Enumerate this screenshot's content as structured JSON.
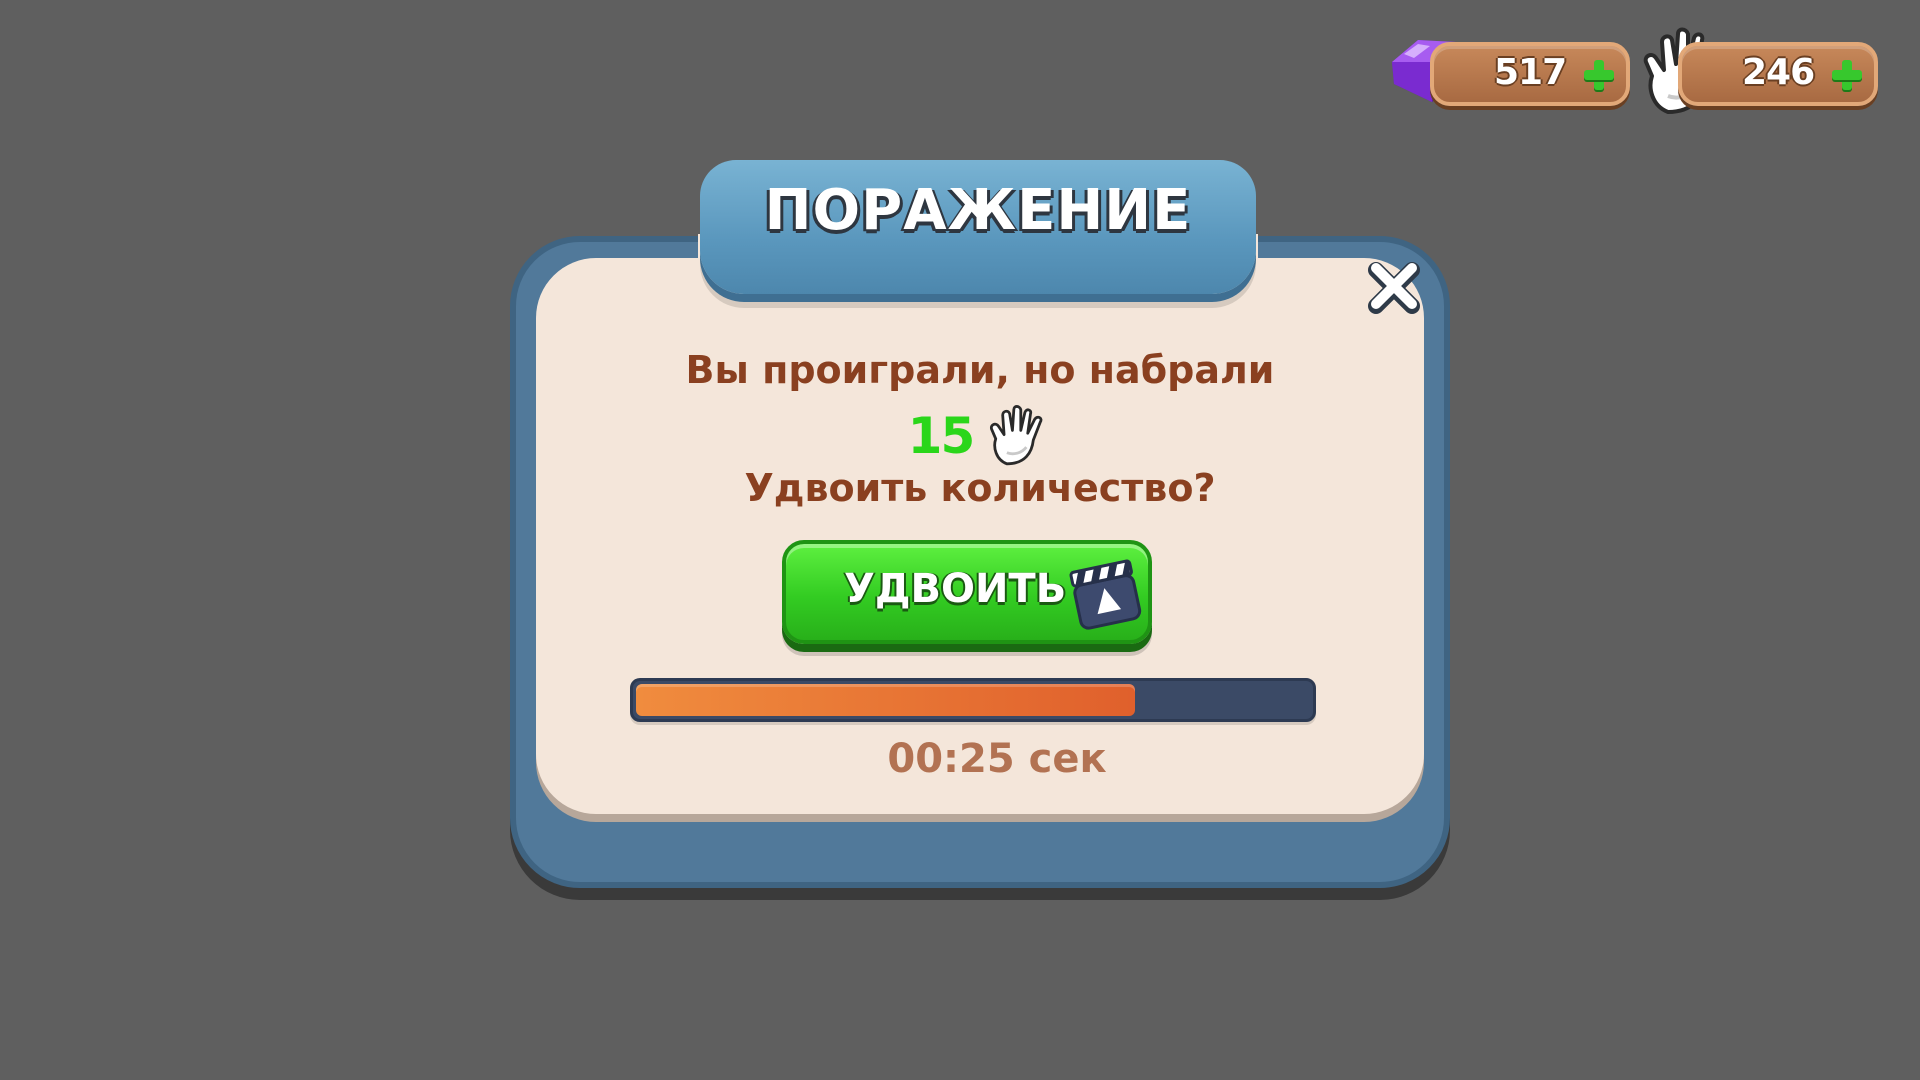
{
  "currencies": {
    "gems": {
      "value": "517",
      "icon": "gem-icon",
      "color": "#8a2be2"
    },
    "hands": {
      "value": "246",
      "icon": "hand-icon"
    }
  },
  "dialog": {
    "title": "ПОРАЖЕНИЕ",
    "close_label": "X",
    "message_line1": "Вы проиграли, но набрали",
    "score": "15",
    "message_line2": "Удвоить количество?",
    "double_button_label": "УДВОИТЬ",
    "progress_fraction": 0.74,
    "timer_text": "00:25 сек"
  },
  "colors": {
    "background": "#5f5f5f",
    "panel": "#51799a",
    "panel_inner": "#f4e6da",
    "text_brown": "#8a4020",
    "score_green": "#2ad61a",
    "button_green": "#33cc22",
    "progress_orange": "#e0602c",
    "progress_track": "#3b4a66"
  }
}
